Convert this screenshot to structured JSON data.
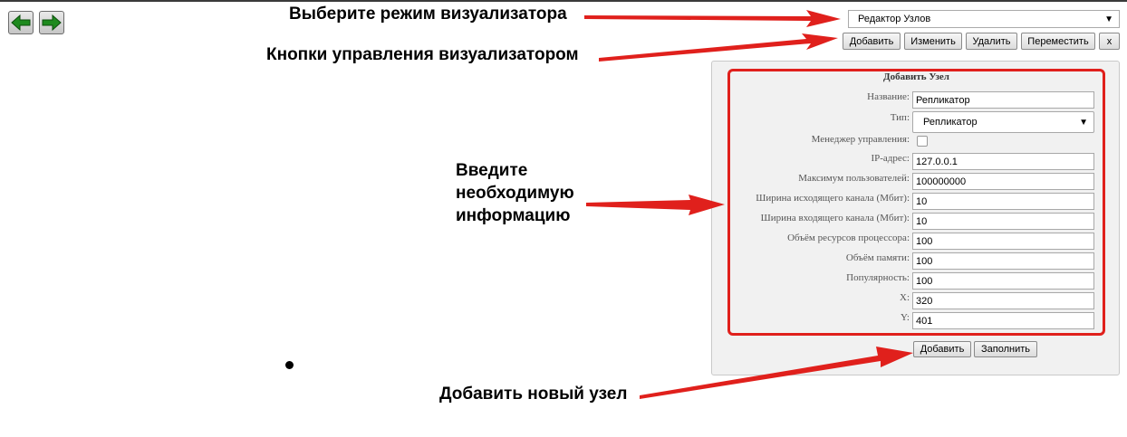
{
  "nav": {
    "back_icon": "arrow-left-icon",
    "forward_icon": "arrow-right-icon",
    "icon_color": "#1e8a1e"
  },
  "toolbar": {
    "mode_select": {
      "value": "Редактор Узлов"
    },
    "buttons": [
      {
        "label": "Добавить"
      },
      {
        "label": "Изменить"
      },
      {
        "label": "Удалить"
      },
      {
        "label": "Переместить"
      },
      {
        "label": "x"
      }
    ]
  },
  "form": {
    "title": "Добавить Узел",
    "fields": [
      {
        "label": "Название:",
        "value": "Репликатор"
      },
      {
        "label": "Тип:",
        "value": "Репликатор"
      },
      {
        "label": "Менеджер управления:",
        "checked": false
      },
      {
        "label": "IP-адрес:",
        "value": "127.0.0.1"
      },
      {
        "label": "Максимум пользователей:",
        "value": "100000000"
      },
      {
        "label": "Ширина исходящего канала (Мбит):",
        "value": "10"
      },
      {
        "label": "Ширина входящего канала (Мбит):",
        "value": "10"
      },
      {
        "label": "Объём ресурсов процессора:",
        "value": "100"
      },
      {
        "label": "Объём памяти:",
        "value": "100"
      },
      {
        "label": "Популярность:",
        "value": "100"
      },
      {
        "label": "X:",
        "value": "320"
      },
      {
        "label": "Y:",
        "value": "401"
      }
    ],
    "add_label": "Добавить",
    "fill_label": "Заполнить"
  },
  "annotations": {
    "mode": "Выберите режим визуализатора",
    "controls": "Кнопки управления визуализатором",
    "enter_line1": "Введите",
    "enter_line2": "необходимую",
    "enter_line3": "информацию",
    "add_node": "Добавить новый узел",
    "arrow_color": "#e0201c"
  }
}
